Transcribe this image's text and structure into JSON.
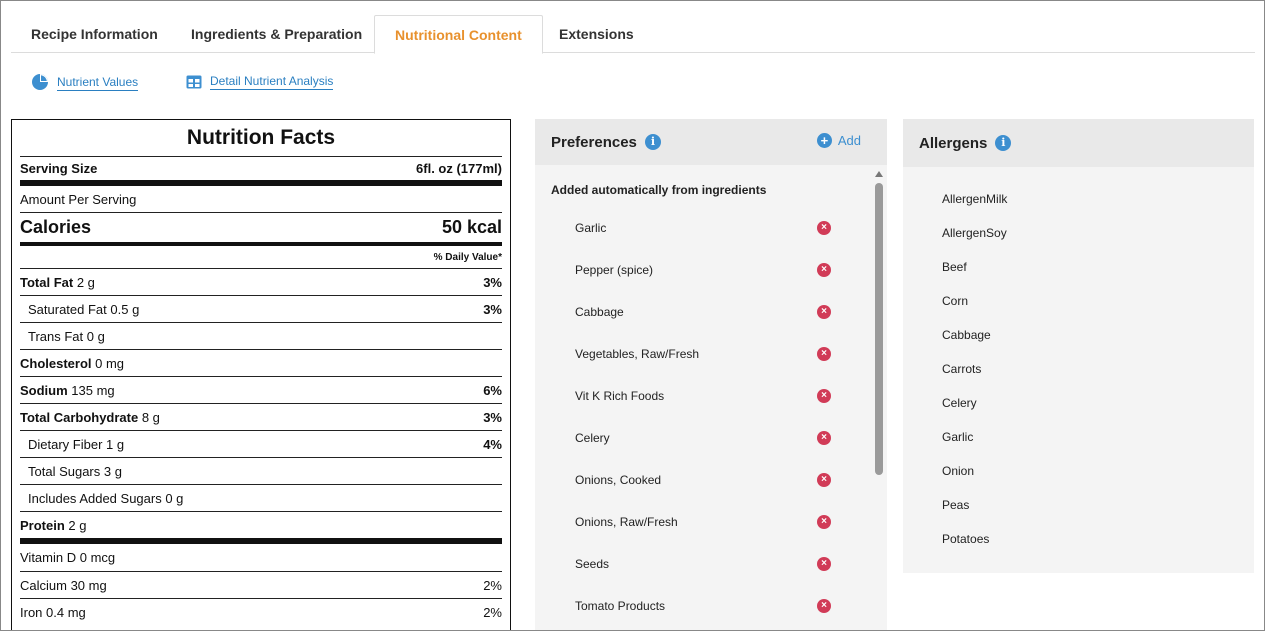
{
  "tabs": [
    {
      "label": "Recipe Information"
    },
    {
      "label": "Ingredients & Preparation"
    },
    {
      "label": "Nutritional Content"
    },
    {
      "label": "Extensions"
    }
  ],
  "sublinks": {
    "nutrient_values": "Nutrient Values",
    "detail_analysis": "Detail Nutrient Analysis"
  },
  "nutrition": {
    "title": "Nutrition Facts",
    "serving_label": "Serving Size",
    "serving_value": "6fl. oz (177ml)",
    "amount_per_serving": "Amount Per Serving",
    "calories_label": "Calories",
    "calories_value": "50 kcal",
    "daily_value_header": "% Daily Value*",
    "rows": [
      {
        "bold": "Total Fat",
        "rest": " 2 g",
        "dv": "3%"
      },
      {
        "bold": "",
        "rest": "Saturated Fat 0.5 g",
        "dv": "3%"
      },
      {
        "bold": "",
        "rest": "Trans Fat 0 g",
        "dv": ""
      },
      {
        "bold": "Cholesterol",
        "rest": " 0 mg",
        "dv": ""
      },
      {
        "bold": "Sodium",
        "rest": " 135 mg",
        "dv": "6%"
      },
      {
        "bold": "Total Carbohydrate",
        "rest": " 8 g",
        "dv": "3%"
      },
      {
        "bold": "",
        "rest": "Dietary Fiber 1 g",
        "dv": "4%"
      },
      {
        "bold": "",
        "rest": "Total Sugars 3 g",
        "dv": ""
      },
      {
        "bold": "",
        "rest": "Includes Added Sugars 0 g",
        "dv": ""
      },
      {
        "bold": "Protein",
        "rest": " 2 g",
        "dv": ""
      }
    ],
    "vitamins": [
      {
        "label": "Vitamin D 0 mcg",
        "dv": ""
      },
      {
        "label": "Calcium 30 mg",
        "dv": "2%"
      },
      {
        "label": "Iron 0.4 mg",
        "dv": "2%"
      }
    ]
  },
  "preferences": {
    "title": "Preferences",
    "add_label": "Add",
    "subtitle": "Added automatically from ingredients",
    "items": [
      "Garlic",
      "Pepper (spice)",
      "Cabbage",
      "Vegetables, Raw/Fresh",
      "Vit K Rich Foods",
      "Celery",
      "Onions, Cooked",
      "Onions, Raw/Fresh",
      "Seeds",
      "Tomato Products"
    ]
  },
  "allergens": {
    "title": "Allergens",
    "items": [
      "AllergenMilk",
      "AllergenSoy",
      "Beef",
      "Corn",
      "Cabbage",
      "Carrots",
      "Celery",
      "Garlic",
      "Onion",
      "Peas",
      "Potatoes"
    ]
  },
  "colors": {
    "accent": "#e8912d",
    "link": "#2a7fc1",
    "info": "#3d8fd0",
    "remove": "#d13b57"
  },
  "icons": {
    "nutrient_values": "pie-chart-icon",
    "detail_analysis": "table-grid-icon",
    "info": "info-icon",
    "add": "plus-circle-icon",
    "remove": "remove-x-icon"
  }
}
